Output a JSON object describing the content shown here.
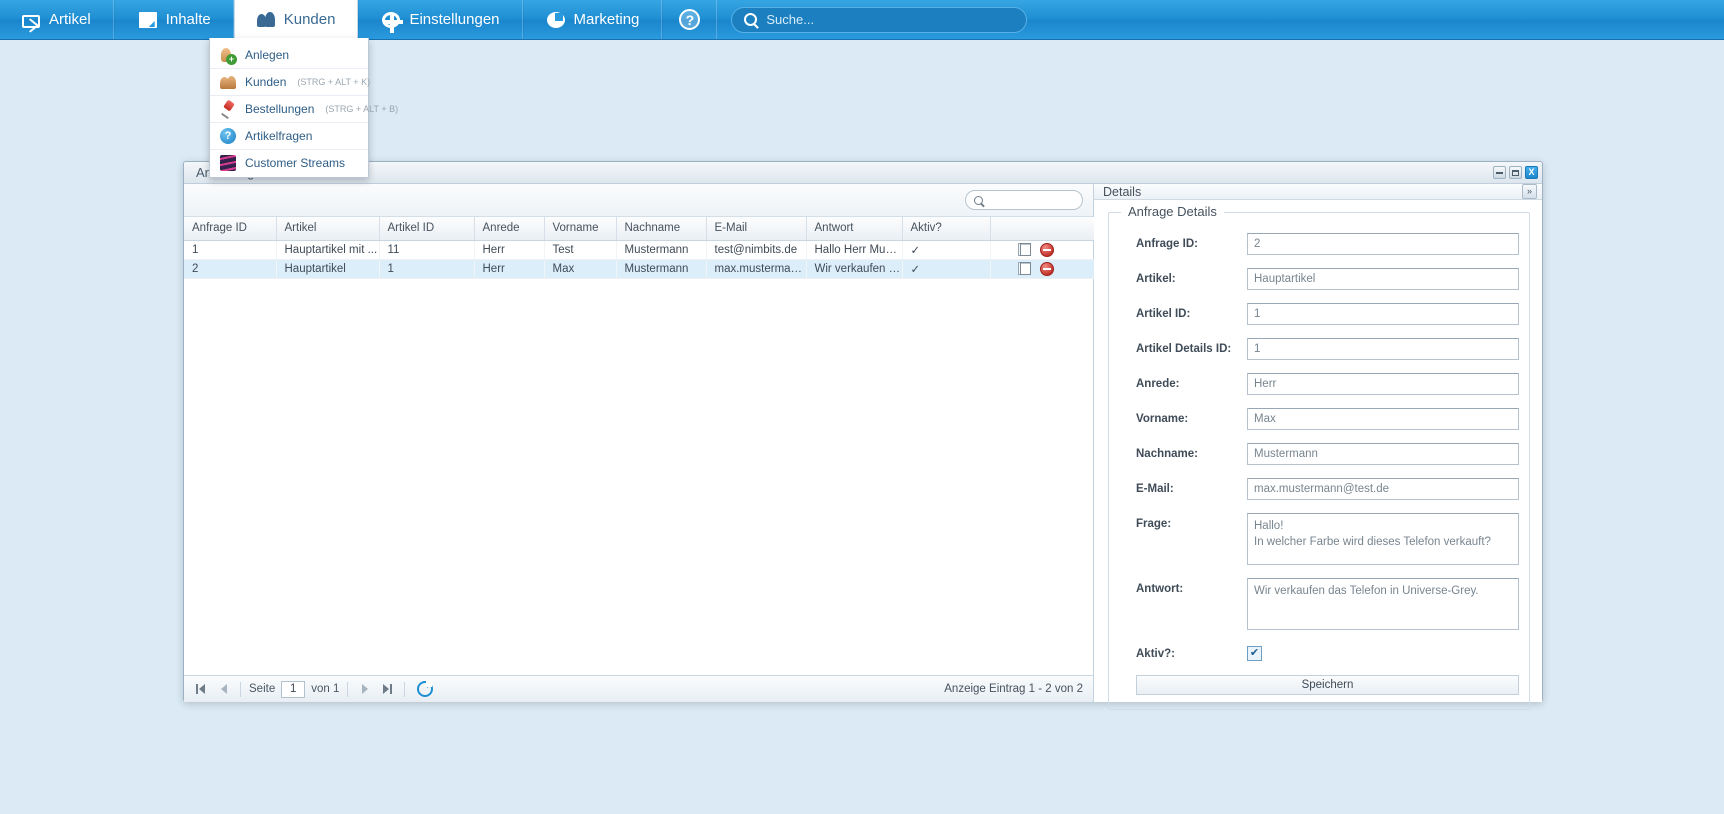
{
  "topnav": {
    "items": [
      {
        "label": "Artikel",
        "icon": "envelope-icon",
        "active": false
      },
      {
        "label": "Inhalte",
        "icon": "page-icon",
        "active": false
      },
      {
        "label": "Kunden",
        "icon": "people-icon",
        "active": true
      },
      {
        "label": "Einstellungen",
        "icon": "gear-icon",
        "active": false
      },
      {
        "label": "Marketing",
        "icon": "pie-chart-icon",
        "active": false
      }
    ],
    "help_glyph": "?",
    "search": {
      "value": "",
      "placeholder": "Suche..."
    }
  },
  "dropdown": {
    "items": [
      {
        "label": "Anlegen",
        "shortcut": "",
        "icon": "add-user-icon"
      },
      {
        "label": "Kunden",
        "shortcut": "(STRG + ALT + K)",
        "icon": "users-icon"
      },
      {
        "label": "Bestellungen",
        "shortcut": "(STRG + ALT + B)",
        "icon": "pin-icon"
      },
      {
        "label": "Artikelfragen",
        "shortcut": "",
        "icon": "question-icon"
      },
      {
        "label": "Customer Streams",
        "shortcut": "",
        "icon": "stream-icon"
      }
    ]
  },
  "window": {
    "title": "Artikelfragen",
    "controls": {
      "minimize": "minimize-icon",
      "maximize": "maximize-icon",
      "close": "X"
    }
  },
  "grid": {
    "search": {
      "value": "",
      "placeholder": ""
    },
    "columns": [
      "Anfrage ID",
      "Artikel",
      "Artikel ID",
      "Anrede",
      "Vorname",
      "Nachname",
      "E-Mail",
      "Antwort",
      "Aktiv?",
      ""
    ],
    "rows": [
      {
        "anfrage_id": "1",
        "artikel": "Hauptartikel mit ...",
        "artikel_id": "11",
        "anrede": "Herr",
        "vorname": "Test",
        "nachname": "Mustermann",
        "email": "test@nimbits.de",
        "antwort": "Hallo Herr Must...",
        "aktiv": "✓",
        "selected": false
      },
      {
        "anfrage_id": "2",
        "artikel": "Hauptartikel",
        "artikel_id": "1",
        "anrede": "Herr",
        "vorname": "Max",
        "nachname": "Mustermann",
        "email": "max.musterman...",
        "antwort": "Wir verkaufen d...",
        "aktiv": "✓",
        "selected": true
      }
    ],
    "footer": {
      "page_label": "Seite",
      "page_value": "1",
      "of_label": "von 1",
      "status": "Anzeige Eintrag 1 - 2 von 2",
      "first_icon": "first-page-icon",
      "prev_icon": "prev-page-icon",
      "next_icon": "next-page-icon",
      "last_icon": "last-page-icon",
      "refresh_icon": "refresh-icon"
    }
  },
  "details": {
    "header": "Details",
    "collapse_glyph": "»",
    "legend": "Anfrage Details",
    "fields": [
      {
        "label": "Anfrage ID:",
        "value": "2"
      },
      {
        "label": "Artikel:",
        "value": "Hauptartikel"
      },
      {
        "label": "Artikel ID:",
        "value": "1"
      },
      {
        "label": "Artikel Details ID:",
        "value": "1"
      },
      {
        "label": "Anrede:",
        "value": "Herr"
      },
      {
        "label": "Vorname:",
        "value": "Max"
      },
      {
        "label": "Nachname:",
        "value": "Mustermann"
      },
      {
        "label": "E-Mail:",
        "value": "max.mustermann@test.de"
      }
    ],
    "frage": {
      "label": "Frage:",
      "value": "Hallo!\nIn welcher Farbe wird dieses Telefon verkauft?"
    },
    "antwort": {
      "label": "Antwort:",
      "value": "Wir verkaufen das Telefon in Universe-Grey."
    },
    "aktiv": {
      "label": "Aktiv?:",
      "checked": true,
      "glyph": "✔"
    },
    "save_label": "Speichern"
  },
  "colors": {
    "nav_blue": "#1f8fd4",
    "accent": "#2e5d86",
    "selected_row": "#ddeefb",
    "delete_red": "#c02d25",
    "page_bg": "#dbeaf5"
  }
}
